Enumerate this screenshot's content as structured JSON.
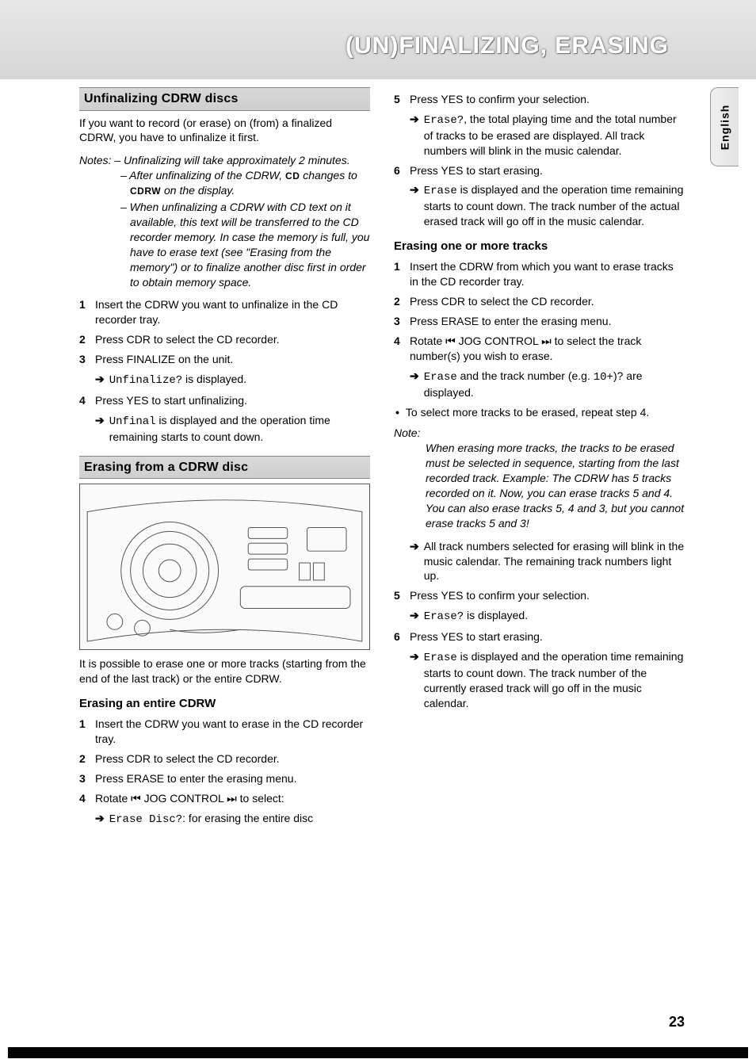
{
  "header": {
    "title": "(UN)FINALIZING, ERASING"
  },
  "language_tab": "English",
  "page_number": "23",
  "left": {
    "sec1": {
      "heading": "Unfinalizing CDRW discs",
      "intro": "If you want to record (or erase) on (from) a finalized CDRW, you have to unfinalize it first.",
      "notes_label": "Notes:",
      "note1": "– Unfinalizing will take approximately 2 minutes.",
      "note2_pre": "– After unfinalizing of the CDRW, ",
      "note2_cd": "CD",
      "note2_mid": " changes to ",
      "note2_cdrw": "CDRW",
      "note2_post": " on the display.",
      "note3": "– When unfinalizing a CDRW with CD text on it available, this text will be transferred to the CD recorder memory. In case the memory is full, you have to erase text (see \"Erasing from the memory\") or to finalize another disc first in order to obtain memory space.",
      "step1": "Insert the CDRW you want to unfinalize in the CD recorder tray.",
      "step2": "Press CDR to select the CD recorder.",
      "step3": "Press FINALIZE on the unit.",
      "step3_sub_text": "Unfinalize?",
      "step3_sub_tail": " is displayed.",
      "step4": "Press YES to start unfinalizing.",
      "step4_sub_text": "Unfinal",
      "step4_sub_tail": " is displayed and the operation time remaining starts to count down."
    },
    "sec2": {
      "heading": "Erasing from a CDRW disc",
      "illus_name": "cd-recorder-control-panel-illustration",
      "intro": "It is possible to erase one or more tracks (starting from the end of the last track) or the entire CDRW.",
      "sub_heading": "Erasing an entire CDRW",
      "step1": "Insert the CDRW you want to erase in the CD recorder tray.",
      "step2": "Press CDR to select the CD recorder.",
      "step3": "Press ERASE to enter the erasing menu.",
      "step4_pre": "Rotate ",
      "step4_icon1": "⏮",
      "step4_mid": " JOG CONTROL ",
      "step4_icon2": "⏭",
      "step4_post": " to select:",
      "step4_sub_text": "Erase Disc?",
      "step4_sub_tail": ": for erasing the entire disc"
    }
  },
  "right": {
    "cont": {
      "step5": "Press YES to confirm your selection.",
      "step5_sub_text": "Erase?",
      "step5_sub_tail": ", the total playing time and the total number of tracks to be erased are displayed. All track numbers will blink in the music calendar.",
      "step6": "Press YES to start erasing.",
      "step6_sub_text": "Erase",
      "step6_sub_tail": " is displayed and the operation time remaining starts to count down. The track number of the actual erased track will go off in the music calendar."
    },
    "sec3": {
      "heading": "Erasing one or more tracks",
      "step1": "Insert the CDRW from which you want to erase tracks in the CD recorder tray.",
      "step2": "Press CDR to select the CD recorder.",
      "step3": "Press ERASE to enter the erasing menu.",
      "step4_pre": "Rotate ",
      "step4_icon1": "⏮",
      "step4_mid": " JOG CONTROL ",
      "step4_icon2": "⏭",
      "step4_post": " to select the track number(s) you wish to erase.",
      "step4_sub_text": "Erase",
      "step4_sub_mid": " and the track number (e.g. ",
      "step4_sub_mono": "10+",
      "step4_sub_tail": ")? are displayed.",
      "bullet": "To select more tracks to be erased, repeat step 4.",
      "note_label": "Note:",
      "note_text": "When erasing more tracks, the tracks to be erased must be selected in sequence, starting from the last recorded track. Example: The CDRW has 5 tracks recorded on it. Now, you can erase tracks 5 and 4. You can also erase tracks 5, 4 and 3, but you cannot erase tracks 5 and 3!",
      "arrow_after_note": "All track numbers selected for erasing will blink in the music calendar. The remaining track numbers light up.",
      "step5": "Press YES to confirm your selection.",
      "step5_sub_text": "Erase?",
      "step5_sub_tail": " is displayed.",
      "step6": "Press YES to start erasing.",
      "step6_sub_text": "Erase",
      "step6_sub_tail": " is displayed and the operation time remaining starts to count down. The track number of the currently erased track will go off in the music calendar."
    }
  }
}
